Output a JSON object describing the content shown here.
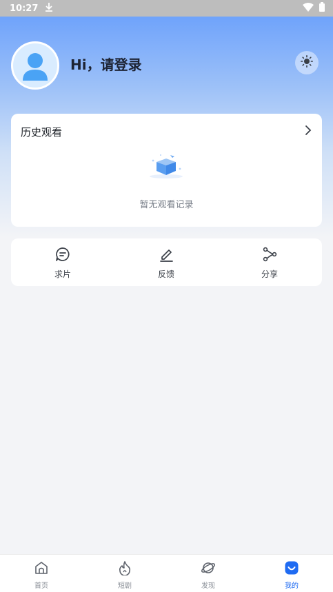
{
  "status_bar": {
    "time": "10:27",
    "icons": [
      "download-icon",
      "wifi-icon",
      "battery-icon"
    ]
  },
  "profile": {
    "login_text": "Hi，请登录",
    "avatar": "user-avatar-icon",
    "theme_icon": "sun-icon"
  },
  "history": {
    "title": "历史观看",
    "empty_text": "暂无观看记录",
    "arrow_icon": "chevron-right-icon",
    "empty_icon": "empty-box-illustration"
  },
  "actions": [
    {
      "label": "求片",
      "icon": "chat-request-icon"
    },
    {
      "label": "反馈",
      "icon": "pencil-icon"
    },
    {
      "label": "分享",
      "icon": "share-icon"
    }
  ],
  "tabs": [
    {
      "label": "首页",
      "icon": "home-icon",
      "active": false
    },
    {
      "label": "短剧",
      "icon": "flame-icon",
      "active": false
    },
    {
      "label": "发现",
      "icon": "planet-icon",
      "active": false
    },
    {
      "label": "我的",
      "icon": "profile-smile-icon",
      "active": true
    }
  ],
  "colors": {
    "accent": "#1f6bf2",
    "hero_top": "#6fa3fb",
    "background": "#f3f4f7"
  }
}
